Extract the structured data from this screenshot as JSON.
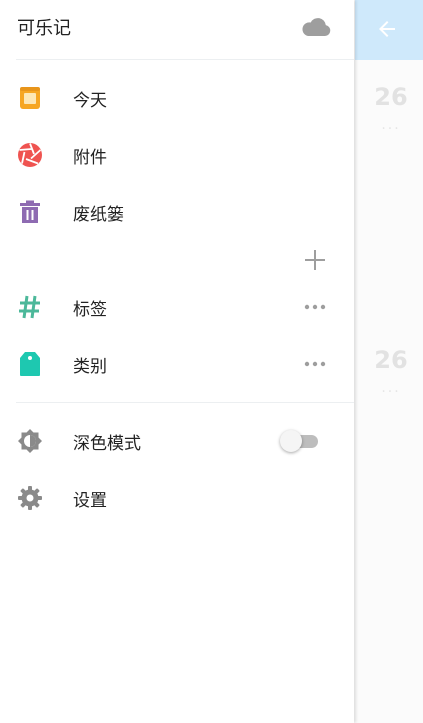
{
  "app": {
    "title": "可乐记"
  },
  "background": {
    "days": [
      {
        "day": "26",
        "more": "···"
      },
      {
        "day": "26",
        "more": "···"
      }
    ]
  },
  "menu": {
    "primary": [
      {
        "label": "今天",
        "icon": "calendar-today-icon",
        "color": "#f6a623"
      },
      {
        "label": "附件",
        "icon": "aperture-icon",
        "color": "#ef5350"
      },
      {
        "label": "废纸篓",
        "icon": "trash-icon",
        "color": "#8e6bb2"
      }
    ],
    "tags": {
      "label": "标签",
      "icon": "hashtag-icon",
      "color": "#4cb89a"
    },
    "categories": {
      "label": "类别",
      "icon": "tag-icon",
      "color": "#1ec8b0"
    },
    "dark_mode": {
      "label": "深色模式",
      "icon": "brightness-icon",
      "enabled": false
    },
    "settings": {
      "label": "设置",
      "icon": "gear-icon"
    }
  },
  "colors": {
    "appbar": "#cfe9fb",
    "icon_gray": "#8a8a8a"
  }
}
